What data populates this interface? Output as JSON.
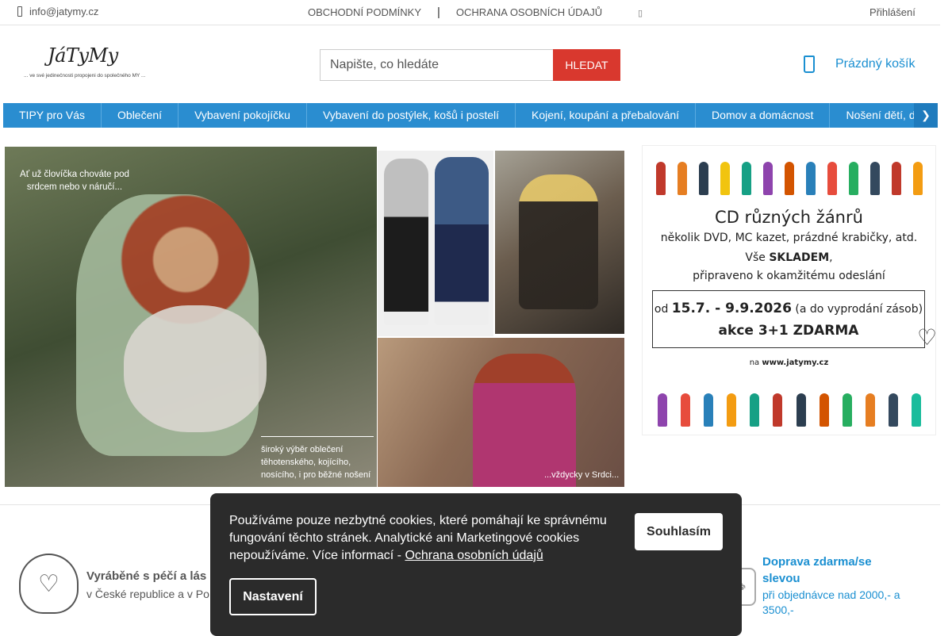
{
  "topbar": {
    "email": "info@jatymy.cz",
    "email_icon": "phone-icon",
    "links": [
      "OBCHODNÍ PODMÍNKY",
      "OCHRANA OSOBNÍCH ÚDAJŮ"
    ],
    "separator": "|",
    "flag_glyph": "▯",
    "login": "Přihlášení"
  },
  "header": {
    "logo_text": "JáTyMy",
    "logo_tagline": "... ve své jedinečnosti propojeni do společného MY ...",
    "search_placeholder": "Napište, co hledáte",
    "search_button": "HLEDAT",
    "cart_label": "Prázdný košík"
  },
  "nav": {
    "items": [
      "TIPY pro Vás",
      "Oblečení",
      "Vybavení pokojíčku",
      "Vybavení do postýlek, košů i postelí",
      "Kojení, koupání a přebalování",
      "Domov a domácnost",
      "Nošení dětí, d"
    ],
    "arrow": "❯"
  },
  "banners": {
    "main_text_top": "Ať už človíčka chováte pod srdcem nebo v náručí...",
    "main_text_bottom_1": "široký výběr oblečení",
    "main_text_bottom_2": "těhotenského, kojícího,",
    "main_text_bottom_3": "nosícího, i pro běžné nošení",
    "bottom_right_text": "...vždycky v Srdci..."
  },
  "promo": {
    "title": "CD různých žánrů",
    "line2": "několik DVD, MC kazet, prázdné krabičky, atd.",
    "line3_pre": "Vše ",
    "line3_bold": "SKLADEM",
    "line3_post": ",",
    "line4": "připraveno k okamžitému odeslání",
    "date_pre": "od ",
    "date_range": "15.7. - 9.9.2026",
    "date_post": " (a do vyprodání zásob)",
    "offer": "akce 3+1 ZDARMA",
    "web_pre": "na ",
    "web": "www.jatymy.cz",
    "heart": "♡"
  },
  "features": {
    "f1_title": "Vyráběné s péčí a lás",
    "f1_sub": "v České republice a v Po",
    "f2_title": "Doprava zdarma/se slevou",
    "f2_sub": "při objednávce nad 2000,- a 3500,-"
  },
  "cookie": {
    "message": "Používáme pouze nezbytné cookies, které pomáhají ke správnému fungování těchto stránek. Analytické ani Marketingové cookies nepoužíváme. Více informací - ",
    "link": "Ochrana osobních údajů",
    "accept": "Souhlasím",
    "settings": "Nastavení"
  },
  "colors": {
    "accent_blue": "#2a8dd0",
    "search_red": "#d9382e",
    "cookie_bg": "#2b2b2b"
  }
}
